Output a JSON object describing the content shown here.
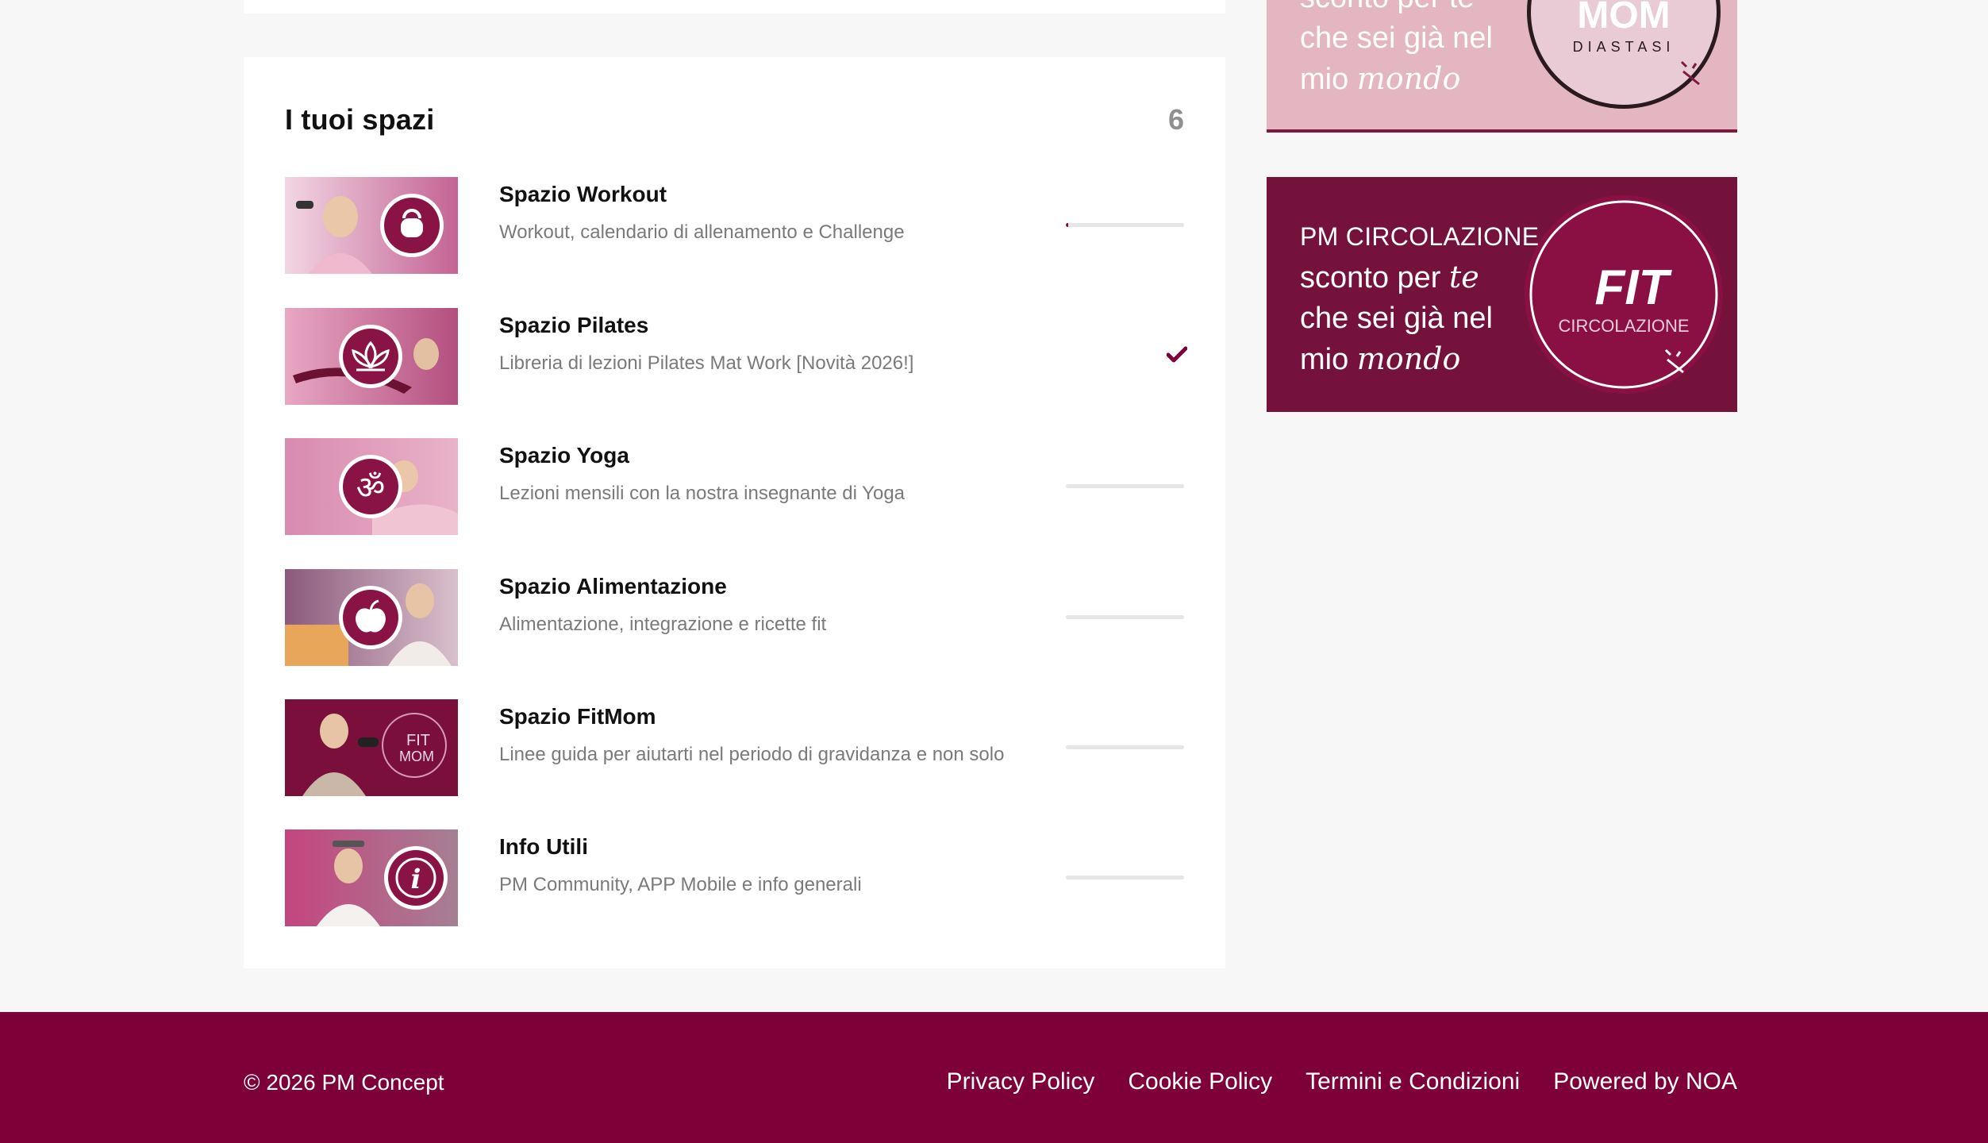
{
  "spaces": {
    "title": "I tuoi spazi",
    "count": "6",
    "items": [
      {
        "title": "Spazio Workout",
        "description": "Workout, calendario di allenamento e Challenge",
        "progress": 0.02,
        "completed": false,
        "icon": "kettlebell-icon"
      },
      {
        "title": "Spazio Pilates",
        "description": "Libreria di lezioni Pilates Mat Work [Novità 2026!]",
        "progress": 1.0,
        "completed": true,
        "icon": "lotus-icon"
      },
      {
        "title": "Spazio Yoga",
        "description": "Lezioni mensili con la nostra insegnante di Yoga",
        "progress": 0,
        "completed": false,
        "icon": "om-icon"
      },
      {
        "title": "Spazio Alimentazione",
        "description": "Alimentazione, integrazione e ricette fit",
        "progress": 0,
        "completed": false,
        "icon": "apple-icon"
      },
      {
        "title": "Spazio FitMom",
        "description": "Linee guida per aiutarti nel periodo di gravidanza e non solo",
        "progress": 0,
        "completed": false,
        "icon": "fitmom-logo-icon"
      },
      {
        "title": "Info Utili",
        "description": "PM Community, APP Mobile e info generali",
        "progress": 0,
        "completed": false,
        "icon": "info-icon"
      }
    ]
  },
  "banners": {
    "diastasi": {
      "line1": "sconto per te",
      "line2": "che sei già nel",
      "line3_prefix": "mio ",
      "line3_script": "mondo",
      "logo_word": "MOM",
      "logo_sub": "DIASTASI"
    },
    "circolazione": {
      "label": "PM CIRCOLAZIONE",
      "line1_prefix": "sconto per ",
      "line1_script": "te",
      "line2": "che sei già nel",
      "line3_prefix": "mio ",
      "line3_script": "mondo",
      "logo_word": "FIT",
      "logo_sub": "CIRCOLAZIONE"
    }
  },
  "footer": {
    "copyright": "© 2026 PM Concept",
    "links": [
      "Privacy Policy",
      "Cookie Policy",
      "Termini e Condizioni",
      "Powered by NOA"
    ]
  },
  "colors": {
    "accent": "#7e0039",
    "banner_dark": "#74123c",
    "banner_light": "#e4b6c1",
    "progress_track": "#e6e6e6"
  }
}
